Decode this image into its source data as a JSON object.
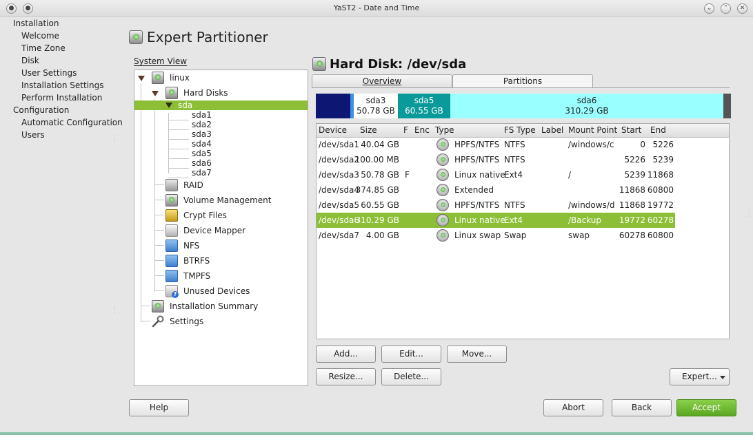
{
  "window": {
    "title": "YaST2 - Date and Time"
  },
  "steps": {
    "installation": "Installation",
    "welcome": "Welcome",
    "time_zone": "Time Zone",
    "disk": "Disk",
    "user_settings": "User Settings",
    "installation_settings": "Installation Settings",
    "perform_installation": "Perform Installation",
    "configuration": "Configuration",
    "automatic_configuration": "Automatic Configuration",
    "users": "Users"
  },
  "page": {
    "title": "Expert Partitioner"
  },
  "tree": {
    "label": "System View",
    "linux": "linux",
    "hard_disks": "Hard Disks",
    "sda": "sda",
    "partitions": [
      "sda1",
      "sda2",
      "sda3",
      "sda4",
      "sda5",
      "sda6",
      "sda7"
    ],
    "raid": "RAID",
    "volume_management": "Volume Management",
    "crypt_files": "Crypt Files",
    "device_mapper": "Device Mapper",
    "nfs": "NFS",
    "btrfs": "BTRFS",
    "tmpfs": "TMPFS",
    "unused_devices": "Unused Devices",
    "installation_summary": "Installation Summary",
    "settings": "Settings"
  },
  "disk": {
    "title": "Hard Disk: /dev/sda",
    "tab_overview": "Overview",
    "tab_partitions": "Partitions",
    "bar": [
      {
        "name": "sda3",
        "size": "50.78 GB"
      },
      {
        "name": "sda5",
        "size": "60.55 GB"
      },
      {
        "name": "sda6",
        "size": "310.29 GB"
      }
    ]
  },
  "table": {
    "headers": [
      "Device",
      "Size",
      "F",
      "Enc",
      "Type",
      "FS Type",
      "Label",
      "Mount Point",
      "Start",
      "End"
    ],
    "rows": [
      {
        "device": "/dev/sda1",
        "size": "40.04 GB",
        "f": "",
        "type": "HPFS/NTFS",
        "fs": "NTFS",
        "label": "",
        "mount": "/windows/c",
        "start": "0",
        "end": "5226"
      },
      {
        "device": "/dev/sda2",
        "size": "100.00 MB",
        "f": "",
        "type": "HPFS/NTFS",
        "fs": "NTFS",
        "label": "",
        "mount": "",
        "start": "5226",
        "end": "5239"
      },
      {
        "device": "/dev/sda3",
        "size": "50.78 GB",
        "f": "F",
        "type": "Linux native",
        "fs": "Ext4",
        "label": "",
        "mount": "/",
        "start": "5239",
        "end": "11868"
      },
      {
        "device": "/dev/sda4",
        "size": "374.85 GB",
        "f": "",
        "type": "Extended",
        "fs": "",
        "label": "",
        "mount": "",
        "start": "11868",
        "end": "60800"
      },
      {
        "device": "/dev/sda5",
        "size": "60.55 GB",
        "f": "",
        "type": "HPFS/NTFS",
        "fs": "NTFS",
        "label": "",
        "mount": "/windows/d",
        "start": "11868",
        "end": "19772"
      },
      {
        "device": "/dev/sda6",
        "size": "310.29 GB",
        "f": "",
        "type": "Linux native",
        "fs": "Ext4",
        "label": "",
        "mount": "/Backup",
        "start": "19772",
        "end": "60278"
      },
      {
        "device": "/dev/sda7",
        "size": "4.00 GB",
        "f": "",
        "type": "Linux swap",
        "fs": "Swap",
        "label": "",
        "mount": "swap",
        "start": "60278",
        "end": "60800"
      }
    ]
  },
  "buttons": {
    "add": "Add...",
    "edit": "Edit...",
    "move": "Move...",
    "resize": "Resize...",
    "delete": "Delete...",
    "expert": "Expert...",
    "help": "Help",
    "abort": "Abort",
    "back": "Back",
    "accept": "Accept"
  },
  "colors": {
    "selection": "#8dbf36",
    "bar_unused": "#0d1672",
    "bar_sda5": "#0a9a9a",
    "bar_sda6": "#99ffff",
    "accept": "#6bb52f"
  }
}
